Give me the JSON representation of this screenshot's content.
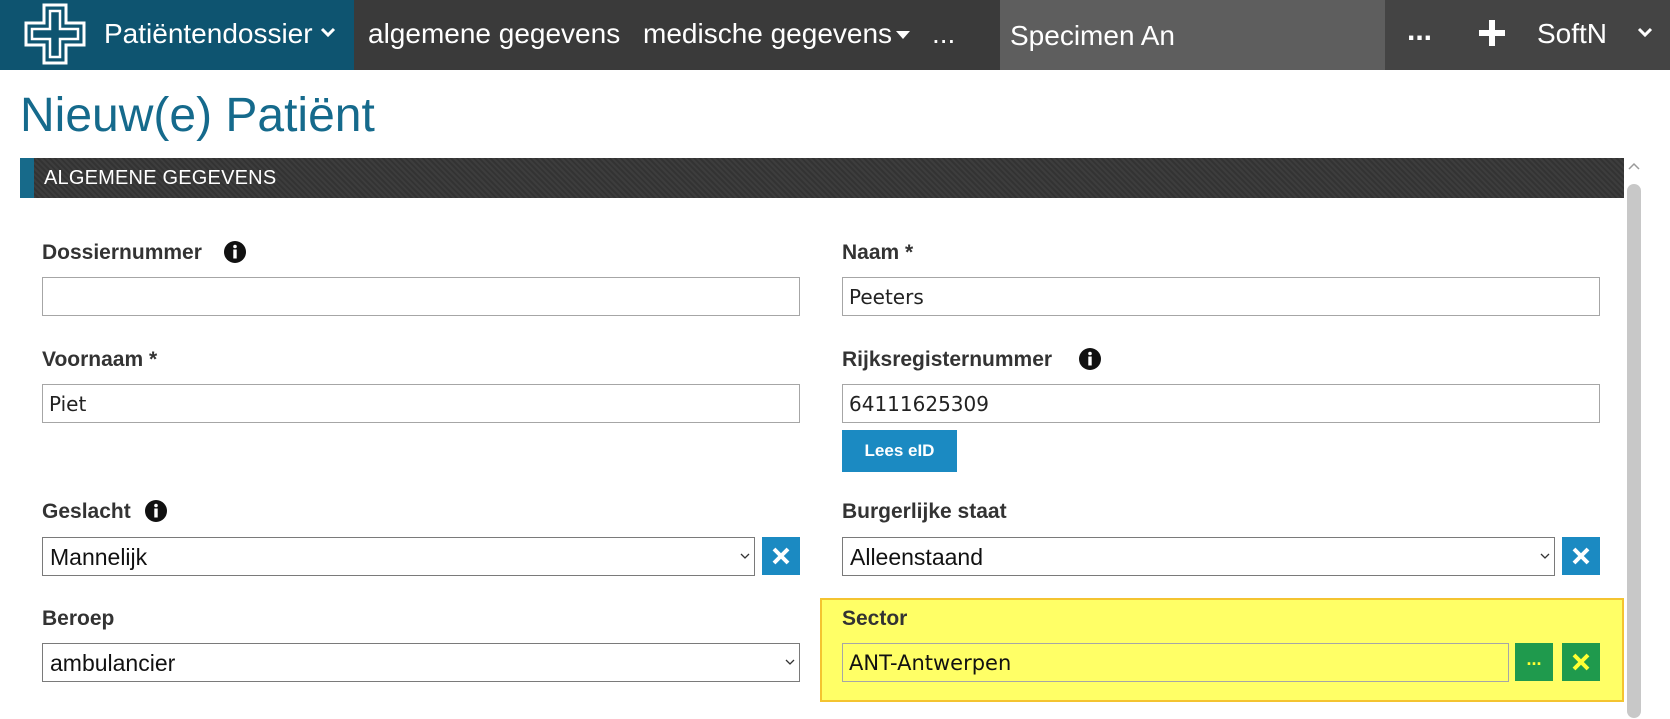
{
  "nav": {
    "brand_label": "Patiëntendossier",
    "links": [
      "algemene gegevens",
      "medische gegevens",
      "..."
    ],
    "patient_name": "Specimen An",
    "more_label": "...",
    "user_label": "SoftN"
  },
  "page": {
    "title": "Nieuw(e) Patiënt",
    "section_title": "ALGEMENE GEGEVENS"
  },
  "form": {
    "dossiernummer": {
      "label": "Dossiernummer",
      "value": ""
    },
    "naam": {
      "label": "Naam *",
      "value": "Peeters"
    },
    "voornaam": {
      "label": "Voornaam *",
      "value": "Piet"
    },
    "rijksregisternummer": {
      "label": "Rijksregisternummer",
      "value": "64111625309"
    },
    "lees_eid_button": "Lees eID",
    "geslacht": {
      "label": "Geslacht",
      "value": "Mannelijk"
    },
    "burgerlijke_staat": {
      "label": "Burgerlijke staat",
      "value": "Alleenstaand"
    },
    "beroep": {
      "label": "Beroep",
      "value": "ambulancier"
    },
    "sector": {
      "label": "Sector",
      "value": "ANT-Antwerpen",
      "browse_label": "..."
    }
  },
  "colors": {
    "brand": "#0e5470",
    "title": "#156a8c",
    "accent_button": "#1b8ac2",
    "highlight": "#ffff66",
    "green_button": "#1f9a4d"
  }
}
